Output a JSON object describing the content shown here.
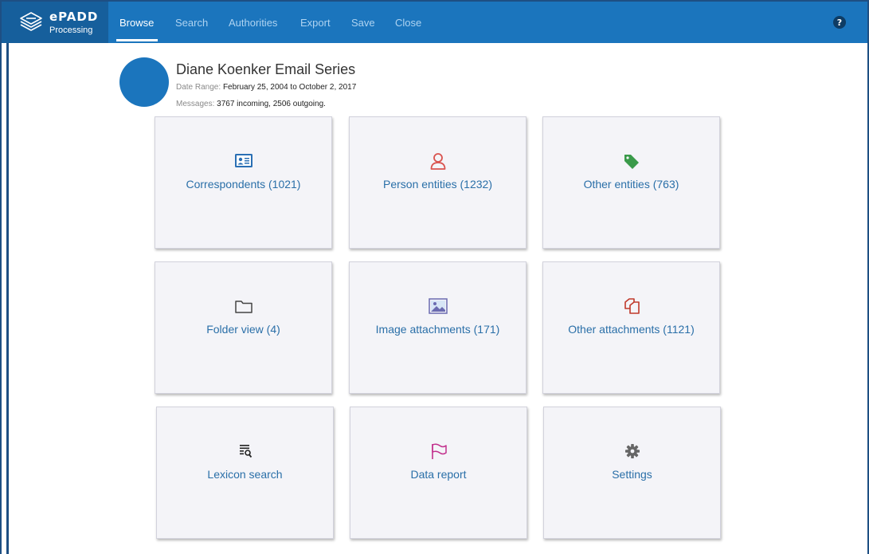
{
  "app": {
    "logo_name": "ePADD",
    "logo_sub": "Processing"
  },
  "nav": {
    "items": [
      {
        "label": "Browse",
        "active": true
      },
      {
        "label": "Search"
      },
      {
        "label": "Authorities"
      },
      {
        "label": "Export"
      },
      {
        "label": "Save"
      },
      {
        "label": "Close"
      }
    ]
  },
  "collection": {
    "title": "Diane Koenker Email Series",
    "date_range_label": "Date Range:",
    "date_range_value": "February 25, 2004 to October 2, 2017",
    "messages_label": "Messages:",
    "messages_value": "3767 incoming, 2506 outgoing."
  },
  "tiles": [
    {
      "label": "Correspondents (1021)",
      "icon": "correspondents-card-icon",
      "color": "#2a6fb4"
    },
    {
      "label": "Person entities (1232)",
      "icon": "person-icon",
      "color": "#d9534f"
    },
    {
      "label": "Other entities (763)",
      "icon": "tag-icon",
      "color": "#3a9a4a"
    },
    {
      "label": "Folder view (4)",
      "icon": "folder-icon",
      "color": "#444444"
    },
    {
      "label": "Image attachments (171)",
      "icon": "image-icon",
      "color": "#6b6bb0"
    },
    {
      "label": "Other attachments (1121)",
      "icon": "attachments-icon",
      "color": "#c0392b"
    },
    {
      "label": "Lexicon search",
      "icon": "lexicon-search-icon",
      "color": "#222222"
    },
    {
      "label": "Data report",
      "icon": "flag-icon",
      "color": "#c2308d"
    },
    {
      "label": "Settings",
      "icon": "gear-icon",
      "color": "#666666"
    }
  ],
  "colors": {
    "topbar": "#1b75bd",
    "logo_bg": "#165f9c",
    "tile_bg": "#f4f4f8",
    "label": "#2a6fa8"
  }
}
